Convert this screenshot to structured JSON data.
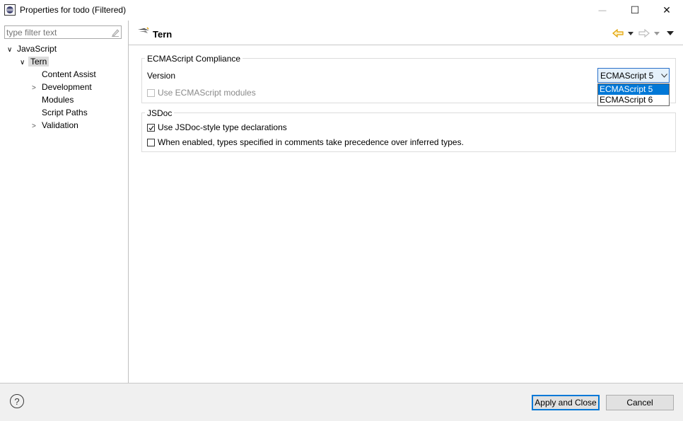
{
  "window": {
    "title": "Properties for todo (Filtered)",
    "controls": {
      "minimize": "—",
      "maximize": "☐",
      "close": "✕"
    }
  },
  "sidebar": {
    "filter_placeholder": "type filter text",
    "tree": [
      {
        "label": "JavaScript",
        "expander": "v"
      },
      {
        "label": "Tern",
        "expander": "v",
        "selected": true
      },
      {
        "label": "Content Assist"
      },
      {
        "label": "Development",
        "expander": ">"
      },
      {
        "label": "Modules"
      },
      {
        "label": "Script Paths"
      },
      {
        "label": "Validation",
        "expander": ">"
      }
    ]
  },
  "page": {
    "title": "Tern",
    "ecma_group": {
      "title": "ECMAScript Compliance",
      "version_label": "Version",
      "selected_version": "ECMAScript 5",
      "options": [
        "ECMAScript 5",
        "ECMAScript 6"
      ],
      "modules_label": "Use ECMAScript modules",
      "modules_checked": false
    },
    "jsdoc_group": {
      "title": "JSDoc",
      "jsdoc_label": "Use JSDoc-style type declarations",
      "jsdoc_checked": true,
      "precedence_label": "When enabled, types specified in comments take precedence over inferred types.",
      "precedence_checked": false
    }
  },
  "footer": {
    "help_glyph": "?",
    "apply_close_label": "Apply and Close",
    "cancel_label": "Cancel"
  },
  "colors": {
    "accent": "#0078d7",
    "arrow": "#e2a100"
  }
}
